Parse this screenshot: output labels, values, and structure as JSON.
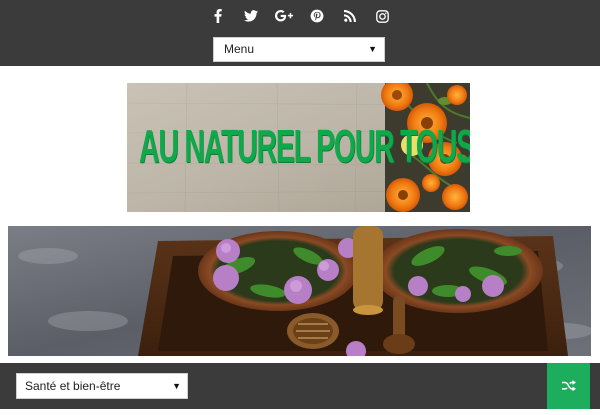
{
  "header": {
    "social_icons": [
      "facebook-icon",
      "twitter-icon",
      "google-plus-icon",
      "pinterest-icon",
      "rss-icon",
      "instagram-icon"
    ],
    "menu_select_label": "Menu",
    "select_arrow": "▼"
  },
  "logo": {
    "text": "AU NATUREL POUR TOUS",
    "text_color": "#0fa84a"
  },
  "banner": {
    "description_icon": "herbal-flowers-tray-image"
  },
  "footer_bar": {
    "category_select_value": "Santé et bien-être",
    "shuffle_icon": "shuffle-icon",
    "accent_color": "#1dae5d"
  }
}
